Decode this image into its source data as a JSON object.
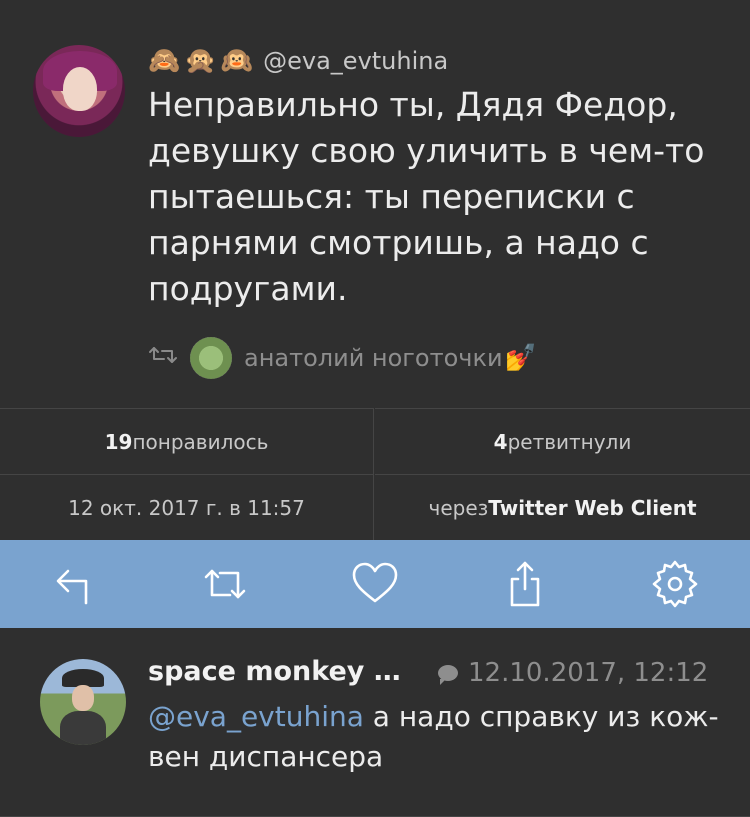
{
  "tweet": {
    "handle": "@eva_evtuhina",
    "emojis": [
      "🙈",
      "🙊",
      "🙉"
    ],
    "text": "Неправильно ты, Дядя Федор, девушку свою уличить в чем-то пытаешься: ты переписки с парнями смотришь, а надо с подругами.",
    "retweeted_by": "анатолий ноготочки",
    "retweeted_by_emoji": "💅"
  },
  "stats": {
    "likes_count": "19",
    "likes_label": " понравилось",
    "retweets_count": "4",
    "retweets_label": " ретвитнули",
    "date": "12 окт. 2017 г. в 11:57",
    "via_label": "через ",
    "client": "Twitter Web Client"
  },
  "toolbar": {
    "icons": [
      "reply-icon",
      "retweet-icon",
      "heart-icon",
      "share-icon",
      "gear-icon"
    ],
    "color": "#7aa3cf"
  },
  "reply": {
    "name": "space monkey …",
    "timestamp": "12.10.2017, 12:12",
    "mention": "@eva_evtuhina",
    "text": " а надо справку из кож-вен диспансера"
  }
}
